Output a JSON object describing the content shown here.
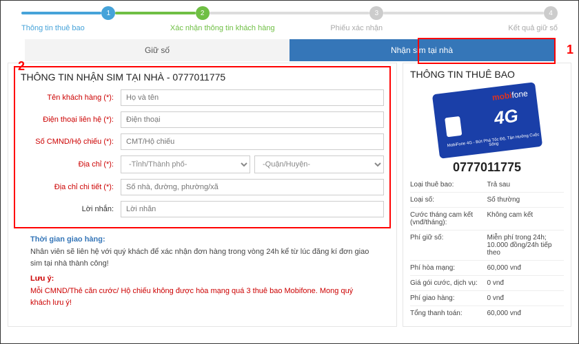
{
  "steps": [
    "1",
    "2",
    "3",
    "4"
  ],
  "stepLabels": [
    "Thông tin thuê bao",
    "Xác nhận thông tin khách hàng",
    "Phiếu xác nhận",
    "Kết quả giữ số"
  ],
  "tabs": {
    "inactive": "Giữ số",
    "active": "Nhận sim tại nhà"
  },
  "annotations": {
    "a1": "1",
    "a2": "2"
  },
  "form": {
    "title": "THÔNG TIN NHẬN SIM TẠI NHÀ - 0777011775",
    "labels": {
      "name": "Tên khách hàng (",
      "phone": "Điện thoại liên hệ (",
      "cmnd": "Số CMND/Hộ chiếu (",
      "addr": "Địa chỉ (",
      "detail": "Địa chỉ chi tiết (",
      "note": "Lời nhắn:",
      "star": "*",
      "close": "):"
    },
    "ph": {
      "name": "Họ và tên",
      "phone": "Điện thoại",
      "cmnd": "CMT/Hộ chiếu",
      "province": "-Tỉnh/Thành phố-",
      "district": "-Quận/Huyện-",
      "detail": "Số nhà, đường, phường/xã",
      "note": "Lời nhắn"
    }
  },
  "delivery": {
    "head": "Thời gian giao hàng:",
    "text": "Nhân viên sẽ liên hệ với quý khách để xác nhận đơn hàng trong vòng 24h kể từ lúc đăng kí đơn giao sim tại nhà thành công!",
    "warnHead": "Lưu ý:",
    "warnText": "Mỗi CMND/Thẻ căn cước/ Hộ chiếu không được hòa mạng quá 3 thuê bao Mobifone. Mong quý khách lưu ý!"
  },
  "right": {
    "title": "THÔNG TIN THUÊ BAO",
    "brand": "mobifone",
    "fg": "4G",
    "sub": "MobiFone 4G - Bứt Phá Tốc Độ, Tận Hưởng Cuộc Sống",
    "number": "0777011775",
    "rows": [
      {
        "k": "Loại thuê bao:",
        "v": "Trả sau"
      },
      {
        "k": "Loại số:",
        "v": "Số thường"
      },
      {
        "k": "Cước tháng cam kết (vnđ/tháng):",
        "v": "Không cam kết"
      },
      {
        "k": "Phí giữ số:",
        "v": "Miễn phí trong 24h; 10.000 đồng/24h tiếp theo"
      },
      {
        "k": "Phí hòa mạng:",
        "v": "60,000 vnđ"
      },
      {
        "k": "Giá gói cước, dịch vụ:",
        "v": "0 vnđ"
      },
      {
        "k": "Phí giao hàng:",
        "v": "0 vnđ"
      },
      {
        "k": "Tổng thanh toán:",
        "v": "60,000 vnđ"
      }
    ]
  }
}
